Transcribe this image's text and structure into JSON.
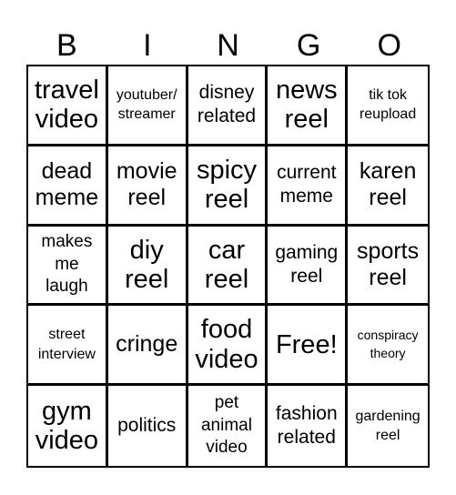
{
  "header": {
    "letters": [
      "B",
      "I",
      "N",
      "G",
      "O"
    ]
  },
  "board": {
    "rows": [
      [
        "travel video",
        "youtuber/ streamer",
        "disney related",
        "news reel",
        "tik tok reupload"
      ],
      [
        "dead meme",
        "movie reel",
        "spicy reel",
        "current meme",
        "karen reel"
      ],
      [
        "makes me laugh",
        "diy reel",
        "car reel",
        "gaming reel",
        "sports reel"
      ],
      [
        "street interview",
        "cringe",
        "food video",
        "Free!",
        "conspiracy theory"
      ],
      [
        "gym video",
        "politics",
        "pet animal video",
        "fashion related",
        "gardening reel"
      ]
    ],
    "free_space": "Free!"
  }
}
